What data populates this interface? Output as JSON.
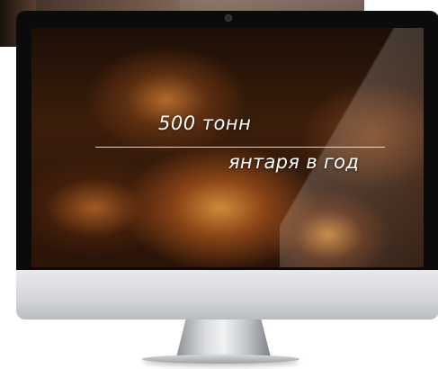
{
  "screen": {
    "headline": "500 тонн",
    "subline": "янтаря в год"
  }
}
